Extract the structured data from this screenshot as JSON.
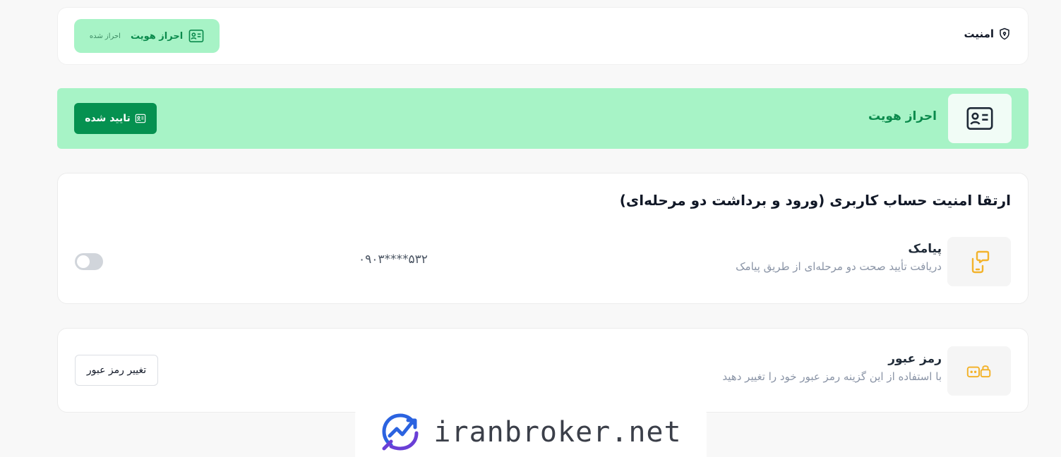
{
  "security": {
    "title": "امنیت",
    "kyc_label": "احراز هویت",
    "kyc_status": "احراز شده"
  },
  "kyc_banner": {
    "title": "احراز هویت",
    "verified_label": "تایید شده"
  },
  "two_factor": {
    "title": "ارتقا امنیت حساب کاربری (ورود و برداشت دو مرحله‌ای)",
    "sms": {
      "name": "پیامک",
      "description": "دریافت تأیید صحت دو مرحله‌ای از طریق پیامک",
      "phone_masked": "۰۹۰۳****۵۳۲",
      "enabled": false
    }
  },
  "password": {
    "name": "رمز عبور",
    "description": "با استفاده از این گزینه رمز عبور خود را تغییر دهید",
    "change_label": "تغییر رمز عبور"
  },
  "watermark": {
    "text": "iranbroker.net"
  },
  "colors": {
    "accent_green": "#059150",
    "light_green": "#a7f3c6",
    "green_text": "#0a8a4c",
    "amber": "#f3b32c"
  }
}
